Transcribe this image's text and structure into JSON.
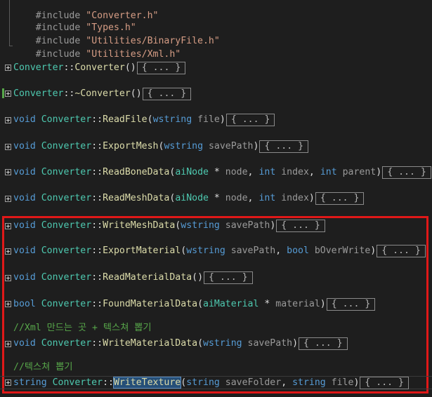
{
  "includes": [
    {
      "directive": "#include",
      "file": "\"Converter.h\""
    },
    {
      "directive": "#include",
      "file": "\"Types.h\""
    },
    {
      "directive": "#include",
      "file": "\"Utilities/BinaryFile.h\""
    },
    {
      "directive": "#include",
      "file": "\"Utilities/Xml.h\""
    }
  ],
  "collapsed_text": "{ ... }",
  "functions": [
    {
      "ret": "",
      "cls": "Converter",
      "sep": "::",
      "name": "Converter",
      "params": "()"
    },
    {
      "ret": "",
      "cls": "Converter",
      "sep": "::",
      "name": "~Converter",
      "params": "()"
    },
    {
      "ret": "void",
      "cls": "Converter",
      "sep": "::",
      "name": "ReadFile",
      "p1_type": "wstring",
      "p1_name": "file"
    },
    {
      "ret": "void",
      "cls": "Converter",
      "sep": "::",
      "name": "ExportMesh",
      "p1_type": "wstring",
      "p1_name": "savePath"
    },
    {
      "ret": "void",
      "cls": "Converter",
      "sep": "::",
      "name": "ReadBoneData",
      "p1_type": "aiNode",
      "p1_ptr": " * ",
      "p1_name": "node",
      "p2_type": "int",
      "p2_name": "index",
      "p3_type": "int",
      "p3_name": "parent"
    },
    {
      "ret": "void",
      "cls": "Converter",
      "sep": "::",
      "name": "ReadMeshData",
      "p1_type": "aiNode",
      "p1_ptr": " * ",
      "p1_name": "node",
      "p2_type": "int",
      "p2_name": "index"
    },
    {
      "ret": "void",
      "cls": "Converter",
      "sep": "::",
      "name": "WriteMeshData",
      "p1_type": "wstring",
      "p1_name": "savePath"
    },
    {
      "ret": "void",
      "cls": "Converter",
      "sep": "::",
      "name": "ExportMaterial",
      "p1_type": "wstring",
      "p1_name": "savePath",
      "p2_type": "bool",
      "p2_name": "bOverWrite"
    },
    {
      "ret": "void",
      "cls": "Converter",
      "sep": "::",
      "name": "ReadMaterialData",
      "params": "()"
    },
    {
      "ret": "bool",
      "cls": "Converter",
      "sep": "::",
      "name": "FoundMaterialData",
      "p1_type": "aiMaterial",
      "p1_ptr": " * ",
      "p1_name": "material"
    },
    {
      "ret": "void",
      "cls": "Converter",
      "sep": "::",
      "name": "WriteMaterialData",
      "p1_type": "wstring",
      "p1_name": "savePath"
    },
    {
      "ret": "string",
      "cls": "Converter",
      "sep": "::",
      "name": "WriteTexture",
      "p1_type": "string",
      "p1_name": "saveFolder",
      "p2_type": "string",
      "p2_name": "file"
    }
  ],
  "comments": [
    "//Xml 만드는 곳 + 텍스쳐 뽑기",
    "//텍스쳐 뽑기"
  ]
}
